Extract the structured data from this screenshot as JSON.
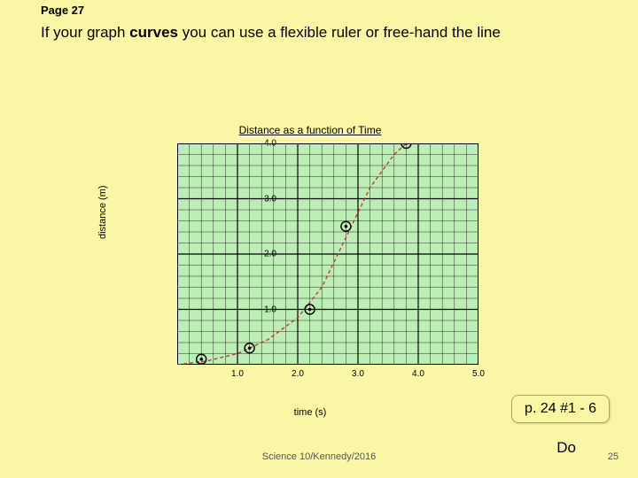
{
  "page_label": "Page 27",
  "instruction_prefix": "If your graph ",
  "instruction_bold": "curves",
  "instruction_suffix": " you can use a flexible ruler or free-hand the line",
  "callout": "p. 24 #1 - 6",
  "do_label": "Do",
  "footer": "Science 10/Kennedy/2016",
  "slide_number": "25",
  "chart_data": {
    "type": "scatter",
    "title": "Distance as a function of Time",
    "xlabel": "time (s)",
    "ylabel": "distance (m)",
    "xlim": [
      0,
      5.0
    ],
    "ylim": [
      0,
      4.0
    ],
    "xticks": [
      "1.0",
      "2.0",
      "3.0",
      "4.0",
      "5.0"
    ],
    "yticks": [
      "1.0",
      "2.0",
      "3.0",
      "4.0"
    ],
    "grid": true,
    "points": [
      {
        "x": 0.4,
        "y": 0.1
      },
      {
        "x": 1.2,
        "y": 0.3
      },
      {
        "x": 2.2,
        "y": 1.0
      },
      {
        "x": 2.8,
        "y": 2.5
      },
      {
        "x": 3.8,
        "y": 4.0
      }
    ],
    "curve": [
      {
        "x": 0.0,
        "y": 0.0
      },
      {
        "x": 0.5,
        "y": 0.07
      },
      {
        "x": 1.0,
        "y": 0.2
      },
      {
        "x": 1.5,
        "y": 0.45
      },
      {
        "x": 2.0,
        "y": 0.85
      },
      {
        "x": 2.4,
        "y": 1.4
      },
      {
        "x": 2.8,
        "y": 2.3
      },
      {
        "x": 3.2,
        "y": 3.2
      },
      {
        "x": 3.6,
        "y": 3.8
      },
      {
        "x": 3.8,
        "y": 4.0
      }
    ]
  }
}
